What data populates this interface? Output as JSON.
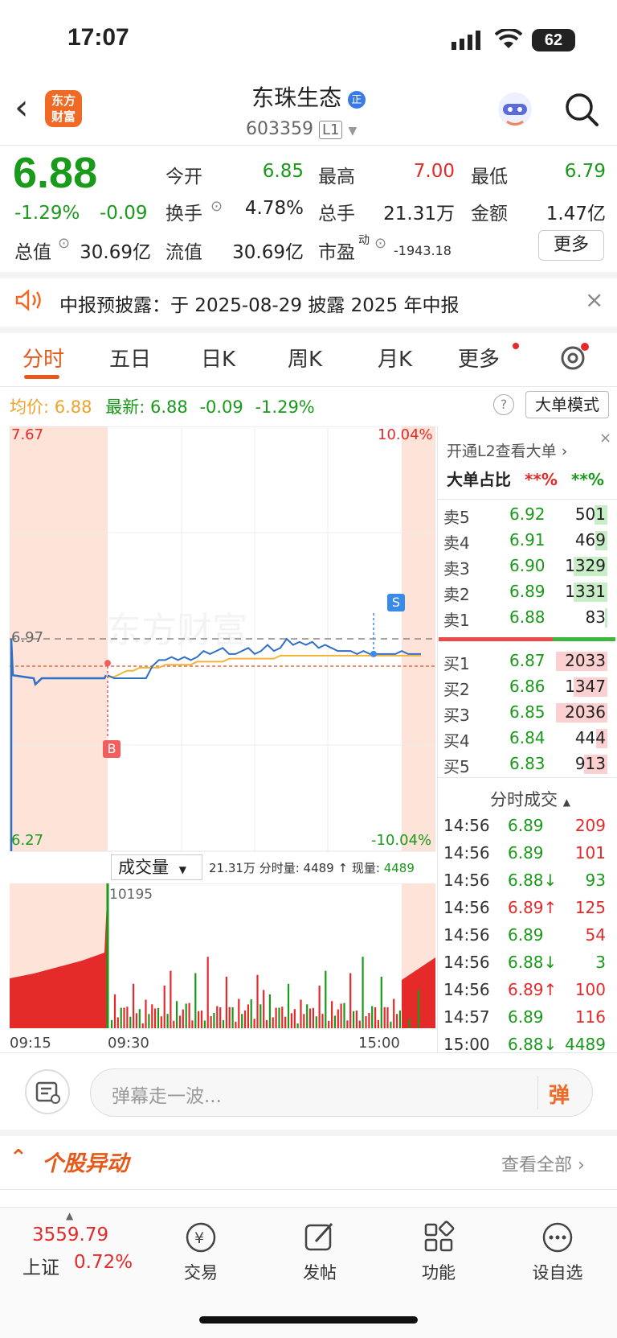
{
  "status_bar": {
    "time": "17:07",
    "battery": "62"
  },
  "header": {
    "back": "‹",
    "logo_top": "东方",
    "logo_bottom": "财富",
    "stock_name": "东珠生态",
    "badge": "正",
    "stock_code": "603359",
    "level": "L1",
    "search": "search"
  },
  "quote": {
    "price": "6.88",
    "change_pct": "-1.29%",
    "change": "-0.09",
    "open_label": "今开",
    "open": "6.85",
    "high_label": "最高",
    "high": "7.00",
    "low_label": "最低",
    "low": "6.79",
    "turnover_label": "换手",
    "turnover": "4.78%",
    "volume_label": "总手",
    "volume": "21.31万",
    "amount_label": "金额",
    "amount": "1.47亿",
    "mcap_label": "总值",
    "mcap": "30.69亿",
    "float_label": "流值",
    "float": "30.69亿",
    "pe_label": "市盈",
    "pe_sup": "动",
    "pe": "-1943.18",
    "more": "更多"
  },
  "notice": {
    "text": "中报预披露：于 2025-08-29 披露 2025 年中报",
    "close": "×"
  },
  "tabs": [
    "分时",
    "五日",
    "日K",
    "周K",
    "月K",
    "更多"
  ],
  "chart_info": {
    "avg_label": "均价:",
    "avg": "6.88",
    "latest_label": "最新:",
    "latest": "6.88",
    "chg": "-0.09",
    "pct": "-1.29%",
    "mode": "大单模式",
    "help": "?"
  },
  "chart_data": {
    "type": "line",
    "y_top": "7.67",
    "y_bottom": "6.27",
    "pct_top": "10.04%",
    "pct_bottom": "-10.04%",
    "ylim": [
      6.27,
      7.67
    ],
    "prev_close": 6.97,
    "buy_level": 6.88,
    "ref_label": "6.97",
    "x_labels": [
      "09:15",
      "09:30",
      "15:00"
    ],
    "price": [
      6.85,
      6.84,
      6.84,
      6.84,
      6.84,
      6.84,
      6.84,
      6.88,
      6.9,
      6.9,
      6.91,
      6.9,
      6.91,
      6.9,
      6.91,
      6.93,
      6.92,
      6.93,
      6.94,
      6.92,
      6.92,
      6.93,
      6.94,
      6.92,
      6.93,
      6.95,
      6.93,
      6.94,
      6.97,
      6.95,
      6.96,
      6.95,
      6.96,
      6.94,
      6.95,
      6.94,
      6.93,
      6.93,
      6.93,
      6.92,
      6.93,
      6.92,
      6.92,
      6.92,
      6.92,
      6.92,
      6.93,
      6.92,
      6.92,
      6.92
    ],
    "avg": [
      6.85,
      6.85,
      6.86,
      6.87,
      6.87,
      6.88,
      6.88,
      6.88,
      6.88,
      6.89,
      6.89,
      6.89,
      6.89,
      6.89,
      6.9,
      6.9,
      6.9,
      6.9,
      6.9,
      6.91,
      6.91,
      6.91,
      6.91,
      6.91,
      6.91,
      6.91,
      6.91,
      6.92,
      6.92,
      6.92,
      6.92,
      6.92,
      6.92,
      6.92,
      6.92,
      6.92,
      6.92,
      6.92,
      6.92,
      6.92,
      6.92,
      6.92,
      6.92,
      6.92,
      6.92,
      6.92,
      6.92,
      6.92,
      6.92,
      6.92
    ],
    "markers": {
      "buy": "B",
      "sell": "S"
    },
    "volume_label": "成交量",
    "total": "21.31万",
    "minute_vol": "分时量: 4489 ↑",
    "now_label": "现量:",
    "now": "4489",
    "vol_max": "10195",
    "volume": [
      30,
      45,
      20,
      60,
      25,
      35,
      28,
      50,
      22,
      40,
      18,
      38,
      26,
      70,
      24,
      33,
      29,
      48,
      21,
      120,
      27,
      36,
      23,
      55,
      30,
      41,
      19,
      62,
      25,
      37,
      28,
      95,
      22,
      45,
      27,
      34,
      20,
      58,
      31,
      44,
      24,
      39,
      26,
      52,
      29,
      47,
      23,
      60,
      35,
      80
    ]
  },
  "order_book": {
    "promo": "开通L2查看大单",
    "ratio_label": "大单占比",
    "ratio_buy": "**%",
    "ratio_sell": "**%",
    "asks": [
      {
        "l": "卖5",
        "p": "6.92",
        "v": "501"
      },
      {
        "l": "卖4",
        "p": "6.91",
        "v": "469"
      },
      {
        "l": "卖3",
        "p": "6.90",
        "v": "1329"
      },
      {
        "l": "卖2",
        "p": "6.89",
        "v": "1331"
      },
      {
        "l": "卖1",
        "p": "6.88",
        "v": "83"
      }
    ],
    "bids": [
      {
        "l": "买1",
        "p": "6.87",
        "v": "2033"
      },
      {
        "l": "买2",
        "p": "6.86",
        "v": "1347"
      },
      {
        "l": "买3",
        "p": "6.85",
        "v": "2036"
      },
      {
        "l": "买4",
        "p": "6.84",
        "v": "444"
      },
      {
        "l": "买5",
        "p": "6.83",
        "v": "913"
      }
    ]
  },
  "trades": {
    "title": "分时成交",
    "rows": [
      {
        "t": "14:56",
        "p": "6.89",
        "v": "209"
      },
      {
        "t": "14:56",
        "p": "6.89",
        "v": "101"
      },
      {
        "t": "14:56",
        "p": "6.88↓",
        "v": "93"
      },
      {
        "t": "14:56",
        "p": "6.89↑",
        "v": "125"
      },
      {
        "t": "14:56",
        "p": "6.89",
        "v": "54"
      },
      {
        "t": "14:56",
        "p": "6.88↓",
        "v": "3"
      },
      {
        "t": "14:56",
        "p": "6.89↑",
        "v": "100"
      },
      {
        "t": "14:57",
        "p": "6.89",
        "v": "116"
      },
      {
        "t": "15:00",
        "p": "6.88↓",
        "v": "4489"
      }
    ]
  },
  "danmu": {
    "placeholder": "弹幕走一波...",
    "send": "弹"
  },
  "anomaly": {
    "title": "个股异动",
    "view_all": "查看全部"
  },
  "bottom_nav": {
    "index_value": "3559.79",
    "index_name": "上证",
    "index_pct": "0.72%",
    "items": [
      "交易",
      "发帖",
      "功能",
      "设自选"
    ]
  }
}
